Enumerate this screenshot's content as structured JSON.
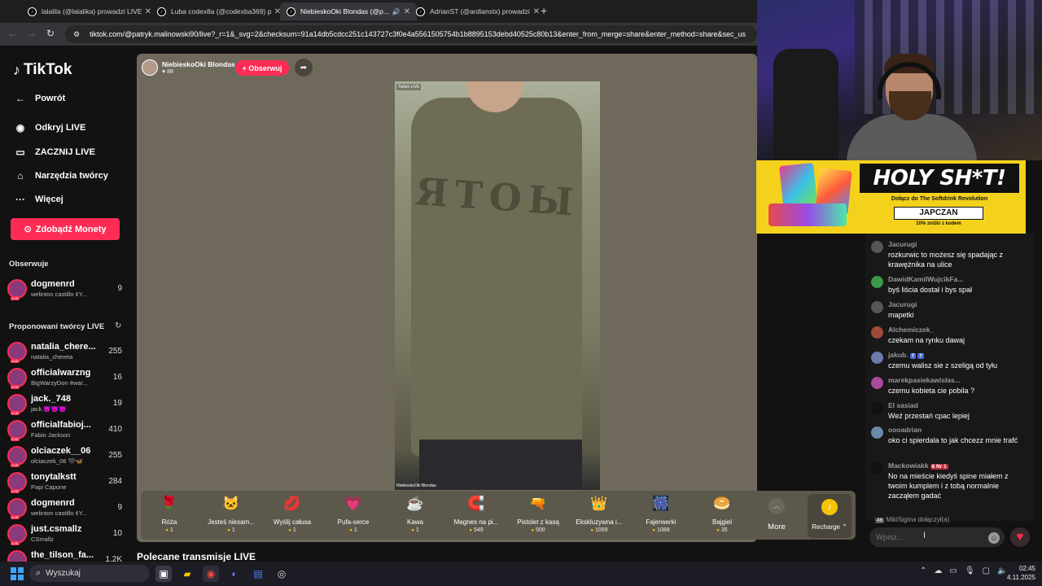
{
  "browser": {
    "tabs": [
      {
        "title": "lalalila (@lalalika) prowadzi LIVE",
        "active": false
      },
      {
        "title": "Luba codex8a (@codexba369) prow",
        "active": false
      },
      {
        "title": "NiebieskoOki Blondas (@p...",
        "active": true
      },
      {
        "title": "AdrianST (@ardianstx) prowadzi",
        "active": false
      }
    ],
    "new_tab": "+",
    "url": "tiktok.com/@patryk.malinowski90/live?_r=1&_svg=2&checksum=91a14db5cdcc251c143727c3f0e4a5561505754b1b8895153debd40525c80b13&enter_from_merge=share&enter_method=share&sec_us"
  },
  "sidebar": {
    "logo": "TikTok",
    "back": "Powrót",
    "nav": [
      {
        "label": "Odkryj LIVE",
        "icon": "live-discover-icon"
      },
      {
        "label": "ZACZNIJ LIVE",
        "icon": "camera-icon"
      },
      {
        "label": "Narzędzia twórcy",
        "icon": "home-icon"
      },
      {
        "label": "Więcej",
        "icon": "more-icon"
      }
    ],
    "coins_button": "Zdobądź Monety",
    "following_header": "Obserwuje",
    "following": [
      {
        "name": "dogmenrd",
        "sub": "welinton castillo ¢Y...",
        "count": "9"
      }
    ],
    "suggested_header": "Proponowani twórcy LIVE",
    "suggested": [
      {
        "name": "natalia_chere...",
        "sub": "natalia_chereta",
        "count": "255"
      },
      {
        "name": "officialwarzng",
        "sub": "BigWarzyDon #war...",
        "count": "16"
      },
      {
        "name": "jack._748",
        "sub": "jack.😈😈😈",
        "count": "19"
      },
      {
        "name": "officialfabioj...",
        "sub": "Fabio Jackson",
        "count": "410"
      },
      {
        "name": "olciaczek__06",
        "sub": "olciaczek_06 🖤🦋",
        "count": "255"
      },
      {
        "name": "tonytalkstt",
        "sub": "Papi Capone",
        "count": "284"
      },
      {
        "name": "dogmenrd",
        "sub": "welinton castillo ¢Y...",
        "count": "9"
      },
      {
        "name": "just.csmallz",
        "sub": "CSmallz",
        "count": "10"
      },
      {
        "name": "the_tilson_fa...",
        "sub": "",
        "count": "1,2K"
      }
    ]
  },
  "stream": {
    "host_name": "NiebieskoOki Blondas",
    "likes": "88",
    "follow_button": "+ Obserwuj",
    "video_tag_top": "Twitch LIVE",
    "video_tag_bottom": "NiebieskoOki Blondas",
    "shirt_text": "ЯTOЫ"
  },
  "gifts": [
    {
      "name": "Róża",
      "price": "1",
      "icon": "🌹"
    },
    {
      "name": "Jesteś niesam...",
      "price": "1",
      "icon": "🐱"
    },
    {
      "name": "Wyślij całusa",
      "price": "1",
      "icon": "💋"
    },
    {
      "name": "Pufa-serce",
      "price": "1",
      "icon": "💗"
    },
    {
      "name": "Kawa",
      "price": "1",
      "icon": "☕"
    },
    {
      "name": "Magnes na pi...",
      "price": "549",
      "icon": "🧲"
    },
    {
      "name": "Pistolet z kasą",
      "price": "500",
      "icon": "🔫"
    },
    {
      "name": "Ekskluzywna i...",
      "price": "1099",
      "icon": "👑"
    },
    {
      "name": "Fajerwerki",
      "price": "1088",
      "icon": "🎆"
    },
    {
      "name": "Bajgiel",
      "price": "35",
      "icon": "🥯"
    }
  ],
  "more_label": "More",
  "recharge_label": "Recharge ⌃",
  "recommended_header": "Polecane transmisje LIVE",
  "ad": {
    "title": "HOLY SH*T!",
    "subtitle": "Dołącz do The Softdrink Revolution",
    "code": "JAPCZAN",
    "discount": "10% zniżki z kodem"
  },
  "chat": {
    "messages": [
      {
        "user": "Jacurugi",
        "text": "rozkurwic to możesz się spadając z krawężnika na ulice",
        "badges": []
      },
      {
        "user": "DawidKamilWujcikFa...",
        "text": "byś liścia dostał i bys spał",
        "badges": []
      },
      {
        "user": "Jacurugi",
        "text": "mapetki",
        "badges": []
      },
      {
        "user": "Alchemiczek_",
        "text": "czekam na rynku dawaj",
        "badges": []
      },
      {
        "user": "jakub.",
        "text": "czemu walisz sie z szeligą od tyłu",
        "badges": [
          "7",
          "7"
        ]
      },
      {
        "user": "marekpasiekawislas...",
        "text": "czemu kobieta cie pobila ?",
        "badges": []
      },
      {
        "user": "El sasiad",
        "text": "Weź przestań cpac lepiej",
        "badges": []
      },
      {
        "user": "oooadrian",
        "text": "oko ci spierdala to jak chcezz mnie trafć",
        "badges": []
      },
      {
        "user": "Mackowiakk",
        "text": "No na mieście kiedyś spine miałem z twoim kumplem i z tobą normalnie zacząłem gadać",
        "badges": [
          "6 Nr 1"
        ]
      }
    ],
    "joined": "MikiSigma dołączył(a)",
    "joined_badge": "46",
    "input_placeholder": "Wpisz..."
  },
  "taskbar": {
    "search": "Wyszukaj",
    "time": "02:45",
    "date": "4.11.2025"
  },
  "colors": {
    "accent": "#fe2c55",
    "coin": "#f5c400",
    "ad_yellow": "#f4d21c"
  }
}
